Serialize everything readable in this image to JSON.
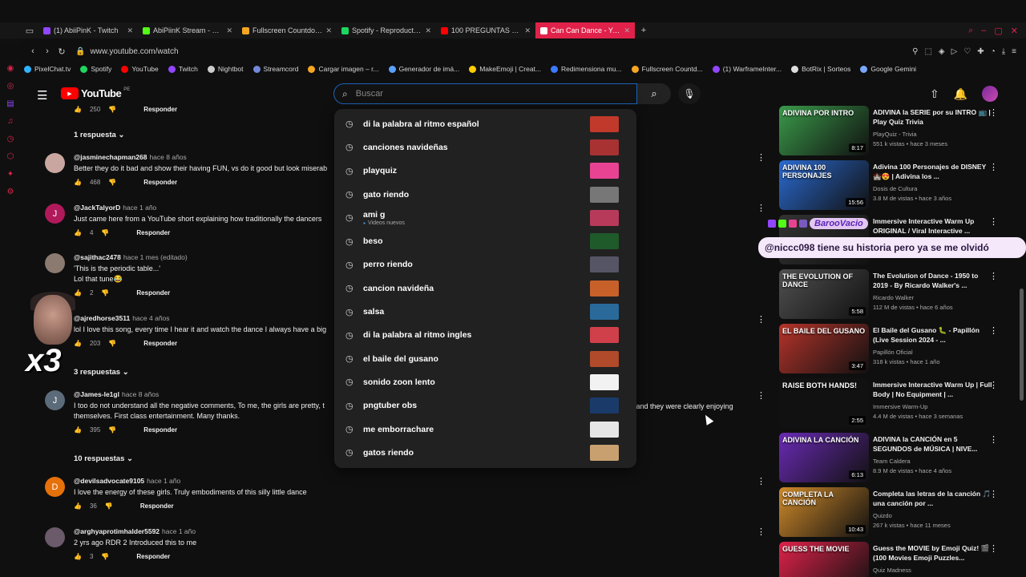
{
  "browser": {
    "tabs": [
      {
        "label": "(1) AbiiPinK - Twitch",
        "color": "#9146ff"
      },
      {
        "label": "AbiPiinK Stream - Wat",
        "color": "#53fc18"
      },
      {
        "label": "Fullscreen Countdown | T",
        "color": "#f5a623"
      },
      {
        "label": "Spotify - Reproductor we",
        "color": "#1ed760"
      },
      {
        "label": "100 PREGUNTAS DEL PE",
        "color": "#ff0000"
      },
      {
        "label": "Can Can Dance - YouTube",
        "color": "#ff0000"
      }
    ],
    "url": "www.youtube.com/watch",
    "bookmarks": [
      {
        "label": "PixelChat.tv",
        "color": "#2fb3ff"
      },
      {
        "label": "Spotify",
        "color": "#1ed760"
      },
      {
        "label": "YouTube",
        "color": "#ff0000"
      },
      {
        "label": "Twitch",
        "color": "#9146ff"
      },
      {
        "label": "Nightbot",
        "color": "#cccccc"
      },
      {
        "label": "Streamcord",
        "color": "#7289da"
      },
      {
        "label": "Cargar imagen – r...",
        "color": "#f5a623"
      },
      {
        "label": "Generador de imá...",
        "color": "#5aa0ff"
      },
      {
        "label": "MakeEmoji | Creat...",
        "color": "#ffcc00"
      },
      {
        "label": "Redimensiona mu...",
        "color": "#3a7bff"
      },
      {
        "label": "Fullscreen Countd...",
        "color": "#f5a623"
      },
      {
        "label": "(1) WarframeInter...",
        "color": "#9146ff"
      },
      {
        "label": "BotRix | Sorteos",
        "color": "#dddddd"
      },
      {
        "label": "Google Gemini",
        "color": "#7aa7ff"
      }
    ]
  },
  "header": {
    "logo_text": "YouTube",
    "logo_region": "PE",
    "search_placeholder": "Buscar"
  },
  "search_suggestions": [
    {
      "label": "di la palabra al ritmo español",
      "sub": "",
      "color": "#c0392b"
    },
    {
      "label": "canciones navideñas",
      "sub": "",
      "color": "#a83232"
    },
    {
      "label": "playquiz",
      "sub": "",
      "color": "#e84393"
    },
    {
      "label": "gato riendo",
      "sub": "",
      "color": "#777777"
    },
    {
      "label": "ami g",
      "sub": "Videos nuevos",
      "color": "#b83a5a"
    },
    {
      "label": "beso",
      "sub": "",
      "color": "#1f5a2a"
    },
    {
      "label": "perro riendo",
      "sub": "",
      "color": "#555566"
    },
    {
      "label": "cancion navideña",
      "sub": "",
      "color": "#c8602a"
    },
    {
      "label": "salsa",
      "sub": "",
      "color": "#2a6a9a"
    },
    {
      "label": "di la palabra al ritmo ingles",
      "sub": "",
      "color": "#d0404a"
    },
    {
      "label": "el baile del gusano",
      "sub": "",
      "color": "#b04a2a"
    },
    {
      "label": "sonido zoon lento",
      "sub": "",
      "color": "#f2f2f2"
    },
    {
      "label": "pngtuber obs",
      "sub": "",
      "color": "#1a3a6a"
    },
    {
      "label": "me emborrachare",
      "sub": "",
      "color": "#e6e6e6"
    },
    {
      "label": "gatos riendo",
      "sub": "",
      "color": "#c8a070"
    }
  ],
  "comments": {
    "top_likes": "250",
    "reply_label": "Responder",
    "toggles": [
      "1 respuesta",
      "3 respuestas",
      "10 respuestas"
    ],
    "items": [
      {
        "handle": "@jasminechapman268",
        "time": "hace 8 años",
        "text": "Better they do it bad and show their having FUN, vs do it good but look miserab",
        "likes": "468",
        "avatar": "#c9a7a0"
      },
      {
        "handle": "@JackTalyorD",
        "time": "hace 1 año",
        "text": "Just came here from a YouTube short explaining how traditionally the dancers",
        "likes": "4",
        "avatar": "#b0195a",
        "initial": "J"
      },
      {
        "handle": "@sajithac2478",
        "time": "hace 1 mes (editado)",
        "text": "'This is the periodic table...'",
        "text2": "Lol that tune😂",
        "likes": "2",
        "avatar": "#8a7a70"
      },
      {
        "handle": "@ajredhorse3511",
        "time": "hace 4 años",
        "text": "lol I love this song, every time I hear it and watch the dance I always have a big",
        "likes": "203",
        "avatar": "#555555"
      },
      {
        "handle": "@James-le1gl",
        "time": "hace 8 años",
        "text": "I too do not understand all the negative comments, To me, the girls are pretty, t",
        "text_tail": "r, and they were clearly enjoying",
        "text2": "themselves.  First class entertainment.  Many thanks.",
        "likes": "395",
        "avatar": "#5c6b7a",
        "initial": "J"
      },
      {
        "handle": "@devilsadvocate9105",
        "time": "hace 1 año",
        "text": "I love the energy of these girls. Truly embodiments of this silly little dance",
        "likes": "36",
        "avatar": "#e6700a",
        "initial": "D"
      },
      {
        "handle": "@arghyaprotimhalder5592",
        "time": "hace 1 año",
        "text": "2 yrs ago RDR 2 Introduced this to me",
        "likes": "3",
        "avatar": "#6a5a6a"
      }
    ]
  },
  "overlay": {
    "webcam_label": "x3",
    "chat_user": "BarooVacio",
    "chat_message": "@niccc098 tiene su historia pero ya se me olvidó"
  },
  "sidebar_videos": [
    {
      "title": "ADIVINA la SERIE por su INTRO 📺 | Play Quiz Trivia",
      "channel": "PlayQuiz - Trivia",
      "meta": "551 k vistas • hace 3 meses",
      "duration": "8:17",
      "color": "#3a9a4a",
      "cap": "ADIVINA POR INTRO"
    },
    {
      "title": "Adivina 100 Personajes de DISNEY 🏰😍 | Adivina los ...",
      "channel": "Dosis de Cultura",
      "meta": "3.8 M de vistas • hace 3 años",
      "duration": "15:56",
      "color": "#2a6ad0",
      "cap": "ADIVINA 100 PERSONAJES"
    },
    {
      "title": "Immersive Interactive Warm Up ORIGINAL / Viral Interactive ...",
      "channel": "",
      "meta": "",
      "duration": "",
      "color": "#333333",
      "cap": ""
    },
    {
      "title": "The Evolution of Dance - 1950 to 2019 - By Ricardo Walker's ...",
      "channel": "Ricardo Walker",
      "meta": "112 M de vistas • hace 6 años",
      "duration": "5:58",
      "color": "#505050",
      "cap": "THE EVOLUTION OF DANCE"
    },
    {
      "title": "El Baile del Gusano 🐛 - Papillón (Live Session 2024 - ...",
      "channel": "Papillón Oficial",
      "meta": "318 k vistas • hace 1 año",
      "duration": "3:47",
      "color": "#b5332a",
      "cap": "EL BAILE DEL GUSANO"
    },
    {
      "title": "Immersive Interactive Warm Up | Full Body | No Equipment | ...",
      "channel": "Immersive Warm-Up",
      "meta": "4.4 M de vistas • hace 3 semanas",
      "duration": "2:55",
      "color": "#111111",
      "cap": "RAISE BOTH HANDS!"
    },
    {
      "title": "ADIVINA la CANCIÓN en 5 SEGUNDOS de MÚSICA | NIVE...",
      "channel": "Team Caldera",
      "meta": "8.9 M de vistas • hace 4 años",
      "duration": "6:13",
      "color": "#6a2ab5",
      "cap": "ADIVINA LA CANCIÓN"
    },
    {
      "title": "Completa las letras de la canción 🎵 una canción por ...",
      "channel": "Quizdo",
      "meta": "267 k vistas • hace 11 meses",
      "duration": "10:43",
      "color": "#d08a2a",
      "cap": "COMPLETA LA CANCIÓN"
    },
    {
      "title": "Guess the MOVIE by Emoji Quiz! 🎬 (100 Movies Emoji Puzzles...",
      "channel": "Quiz Madness",
      "meta": "",
      "duration": "",
      "color": "#e0224a",
      "cap": "GUESS THE MOVIE"
    }
  ]
}
